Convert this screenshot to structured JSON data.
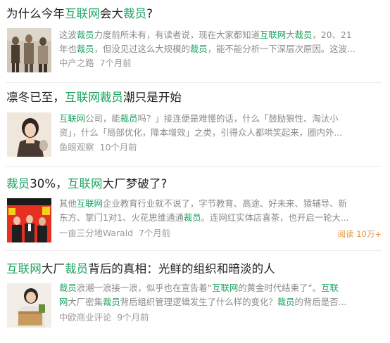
{
  "articles": [
    {
      "title": [
        {
          "text": "为什么今年",
          "hl": false
        },
        {
          "text": "互联网",
          "hl": true
        },
        {
          "text": "会大",
          "hl": false
        },
        {
          "text": "裁员",
          "hl": true
        },
        {
          "text": "?",
          "hl": false
        }
      ],
      "thumb_icon": "people-protest-thumbnail",
      "snippet_lines": [
        [
          {
            "text": "这波",
            "hl": false
          },
          {
            "text": "裁员",
            "hl": true
          },
          {
            "text": "力度前所未有，有读者说，现在大家都知道",
            "hl": false
          },
          {
            "text": "互联网",
            "hl": true
          },
          {
            "text": "大",
            "hl": false
          },
          {
            "text": "裁员",
            "hl": true
          },
          {
            "text": "，20、21",
            "hl": false
          }
        ],
        [
          {
            "text": "年也",
            "hl": false
          },
          {
            "text": "裁员",
            "hl": true
          },
          {
            "text": "，但没见过这么大规模的",
            "hl": false
          },
          {
            "text": "裁员",
            "hl": true
          },
          {
            "text": "，能不能分析一下深层次原因。这波...",
            "hl": false
          }
        ]
      ],
      "author": "中产之路",
      "time": "7个月前"
    },
    {
      "title": [
        {
          "text": "凛冬已至，",
          "hl": false
        },
        {
          "text": "互联网",
          "hl": true
        },
        {
          "text": "裁员",
          "hl": true
        },
        {
          "text": "潮只是开始",
          "hl": false
        }
      ],
      "thumb_icon": "woman-portrait-thumbnail",
      "snippet_lines": [
        [
          {
            "text": "互联网",
            "hl": true
          },
          {
            "text": "公司，能",
            "hl": false
          },
          {
            "text": "裁员",
            "hl": true
          },
          {
            "text": "吗？」接连便是难懂的话，什么「鼓励狼性、淘汰小",
            "hl": false
          }
        ],
        [
          {
            "text": "资」，什么「局部优化，降本增效」之类，引得众人都哄笑起来，圈内外...",
            "hl": false
          }
        ]
      ],
      "author": "鱼眼观察",
      "time": "10个月前"
    },
    {
      "title": [
        {
          "text": "裁员",
          "hl": true
        },
        {
          "text": "30%，",
          "hl": false
        },
        {
          "text": "互联网",
          "hl": true
        },
        {
          "text": "大厂梦破了?",
          "hl": false
        }
      ],
      "thumb_icon": "business-team-thumbnail",
      "snippet_lines": [
        [
          {
            "text": "其他",
            "hl": false
          },
          {
            "text": "互联网",
            "hl": true
          },
          {
            "text": "企业教育行业就不说了，字节教育、高途、好未来、猿辅导、新",
            "hl": false
          }
        ],
        [
          {
            "text": "东方、掌门1对1、火花思维通通",
            "hl": false
          },
          {
            "text": "裁员",
            "hl": true
          },
          {
            "text": "。连网红实体店喜茶，也开启一轮大...",
            "hl": false
          }
        ]
      ],
      "author": "一亩三分地Warald",
      "time": "7个月前",
      "reads": "阅读 10万+"
    },
    {
      "title": [
        {
          "text": "互联网",
          "hl": true
        },
        {
          "text": "大厂",
          "hl": false
        },
        {
          "text": "裁员",
          "hl": true
        },
        {
          "text": "背后的真相：光鲜的组织和暗淡的人",
          "hl": false
        }
      ],
      "thumb_icon": "office-worker-box-thumbnail",
      "snippet_lines": [
        [
          {
            "text": "裁员",
            "hl": true
          },
          {
            "text": "浪潮一浪接一浪，似乎也在宣告着“",
            "hl": false
          },
          {
            "text": "互联网",
            "hl": true
          },
          {
            "text": "的黄金时代结束了”。",
            "hl": false
          },
          {
            "text": "互联",
            "hl": true
          }
        ],
        [
          {
            "text": "网",
            "hl": true
          },
          {
            "text": "大厂密集",
            "hl": false
          },
          {
            "text": "裁员",
            "hl": true
          },
          {
            "text": "背后组织管理逻辑发生了什么样的变化？",
            "hl": false
          },
          {
            "text": "裁员",
            "hl": true
          },
          {
            "text": "的背后是否...",
            "hl": false
          }
        ]
      ],
      "author": "中欧商业评论",
      "time": "9个月前"
    }
  ]
}
